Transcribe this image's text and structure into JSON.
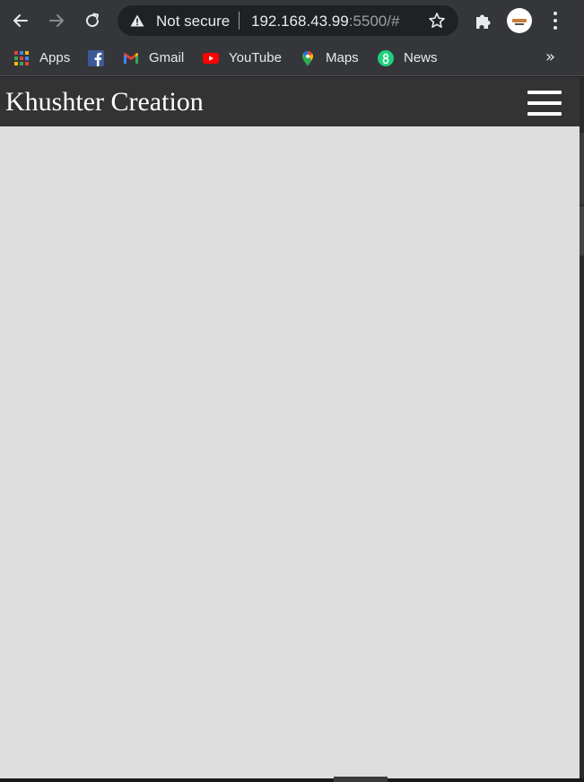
{
  "browser": {
    "address_bar": {
      "security_label": "Not secure",
      "url_host": "192.168.43.99",
      "url_rest": ":5500/#"
    },
    "icons": {
      "back": "back-arrow-icon",
      "forward": "forward-arrow-icon",
      "reload": "reload-icon",
      "warning": "warning-triangle-icon",
      "bookmark": "star-icon",
      "extensions": "puzzle-icon",
      "menu": "kebab-menu-icon"
    },
    "colors": {
      "toolbar": "#35363a",
      "omnibox": "#202124",
      "text": "#e8eaed"
    }
  },
  "bookmarks": {
    "items": [
      {
        "label": "Apps",
        "icon": "apps-grid-icon"
      },
      {
        "label": "",
        "icon": "facebook-icon"
      },
      {
        "label": "Gmail",
        "icon": "gmail-icon"
      },
      {
        "label": "YouTube",
        "icon": "youtube-icon"
      },
      {
        "label": "Maps",
        "icon": "maps-pin-icon"
      },
      {
        "label": "News",
        "icon": "news-icon"
      }
    ],
    "overflow_label": "»"
  },
  "page": {
    "title": "Khushter Creation",
    "menu_icon": "hamburger-icon",
    "colors": {
      "navbar": "#333333",
      "body": "#dedede",
      "title": "#ffffff"
    }
  }
}
